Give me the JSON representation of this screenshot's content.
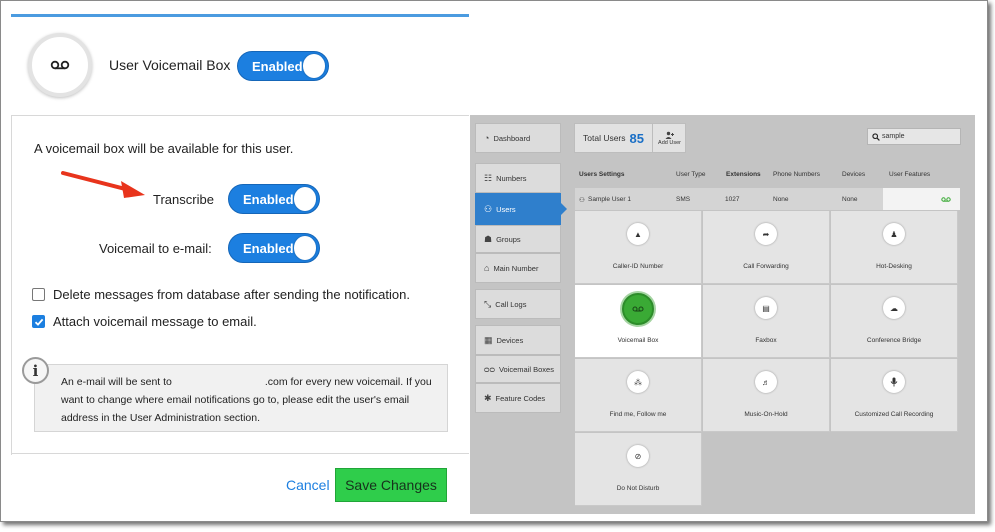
{
  "dialog": {
    "title": "User Voicemail Box",
    "main_toggle": "Enabled",
    "description": "A voicemail box will be available for this user.",
    "transcribe_label": "Transcribe",
    "transcribe_toggle": "Enabled",
    "vm_email_label": "Voicemail to e-mail:",
    "vm_email_toggle": "Enabled",
    "checkbox_delete": "Delete messages from database after sending the notification.",
    "checkbox_attach": "Attach voicemail message to email.",
    "info_part1": "An e-mail will be sent to",
    "info_part2": ".com for every new voicemail. If you want to change where email notifications go to, please edit the user's email address in the User Administration section.",
    "info_icon": "i",
    "cancel": "Cancel",
    "save": "Save Changes"
  },
  "admin": {
    "nav": [
      {
        "label": "Dashboard",
        "icon": "dashboard-icon",
        "glyph": "◔"
      },
      {
        "label": "Numbers",
        "icon": "numbers-icon",
        "glyph": "☷"
      },
      {
        "label": "Users",
        "icon": "users-icon",
        "glyph": "⚇"
      },
      {
        "label": "Groups",
        "icon": "groups-icon",
        "glyph": "☗"
      },
      {
        "label": "Main Number",
        "icon": "home-icon",
        "glyph": "⌂"
      },
      {
        "label": "Call Logs",
        "icon": "call-logs-icon",
        "glyph": "⤡"
      },
      {
        "label": "Devices",
        "icon": "devices-icon",
        "glyph": "▦"
      },
      {
        "label": "Voicemail Boxes",
        "icon": "voicemail-icon",
        "glyph": "ᴑᴑ"
      },
      {
        "label": "Feature Codes",
        "icon": "feature-codes-icon",
        "glyph": "✱"
      }
    ],
    "total_users_label": "Total Users",
    "total_users_count": "85",
    "add_user": "Add User",
    "search_value": "sample",
    "columns": [
      "Users Settings",
      "User Type",
      "Extensions",
      "Phone Numbers",
      "Devices",
      "User Features"
    ],
    "row": {
      "name": "Sample User 1",
      "type": "SMS",
      "extension": "1027",
      "phone": "None",
      "devices": "None"
    },
    "tiles": [
      {
        "label": "Caller-ID Number",
        "glyph": "▲"
      },
      {
        "label": "Call Forwarding",
        "glyph": "➦"
      },
      {
        "label": "Hot-Desking",
        "glyph": "♟"
      },
      {
        "label": "Voicemail Box",
        "glyph": "oo"
      },
      {
        "label": "Faxbox",
        "glyph": "▤"
      },
      {
        "label": "Conference Bridge",
        "glyph": "☁"
      },
      {
        "label": "Find me, Follow me",
        "glyph": "⁂"
      },
      {
        "label": "Music-On-Hold",
        "glyph": "♬"
      },
      {
        "label": "Customized Call Recording",
        "glyph": "🎙"
      },
      {
        "label": "Do Not Disturb",
        "glyph": "⊘"
      }
    ],
    "colors": {
      "accent": "#2f7fcc",
      "green": "#3aaa35",
      "count": "#1a6fc6"
    }
  }
}
